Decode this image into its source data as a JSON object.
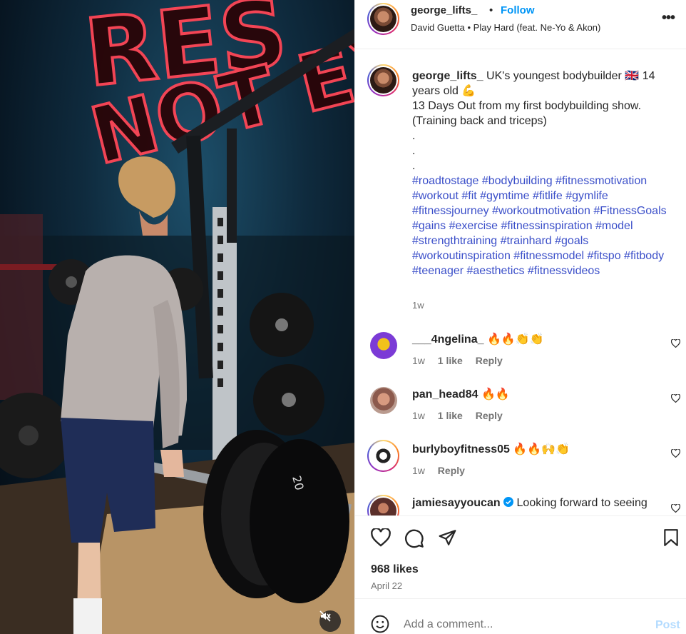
{
  "post": {
    "username": "george_lifts_",
    "follow_label": "Follow",
    "audio": "David Guetta • Play Hard (feat. Ne-Yo & Akon)",
    "caption": {
      "line1": "UK's youngest bodybuilder 🇬🇧 14 years old 💪",
      "line2": "13 Days Out from my first bodybuilding show. (Training back and triceps)",
      "dots": [
        ".",
        ".",
        "."
      ],
      "hashtags": "#roadtostage #bodybuilding #fitnessmotivation #workout #fit #gymtime #fitlife #gymlife #fitnessjourney #workoutmotivation #FitnessGoals #gains #exercise #fitnessinspiration #model #strengthtraining #trainhard #goals #workoutinspiration #fitnessmodel #fitspo #fitbody #teenager #aesthetics #fitnessvideos",
      "time": "1w"
    },
    "likes": "968 likes",
    "date": "April 22"
  },
  "comments": [
    {
      "username": "___4ngelina_",
      "text": "🔥🔥👏👏",
      "time": "1w",
      "likes": "1 like",
      "reply": "Reply"
    },
    {
      "username": "pan_head84",
      "text": "🔥🔥",
      "time": "1w",
      "likes": "1 like",
      "reply": "Reply"
    },
    {
      "username": "burlyboyfitness05",
      "text": "🔥🔥🙌👏",
      "time": "1w",
      "likes": "",
      "reply": "Reply"
    },
    {
      "username": "jamiesayyoucan",
      "text": "Looking forward to seeing"
    }
  ],
  "add_comment": {
    "placeholder": "Add a comment...",
    "post_label": "Post"
  },
  "media": {
    "neon_line1": "RES",
    "neon_line2": "NOT EXCU"
  },
  "colors": {
    "accent": "#0095f6",
    "hashtag": "#3b4fc9",
    "muted": "#737373",
    "post_disabled": "#b3dbff"
  }
}
